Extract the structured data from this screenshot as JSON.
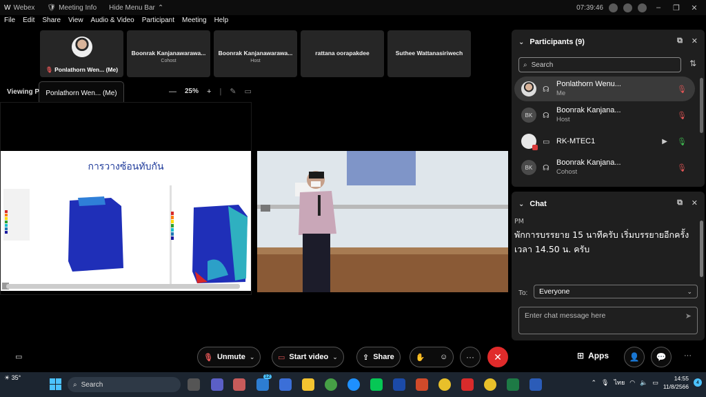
{
  "titlebar": {
    "app_name": "Webex",
    "meeting_info": "Meeting Info",
    "hide_menu": "Hide Menu Bar",
    "time": "07:39:46"
  },
  "menu": [
    "File",
    "Edit",
    "Share",
    "View",
    "Audio & Video",
    "Participant",
    "Meeting",
    "Help"
  ],
  "tiles": [
    {
      "name": "Ponlathorn Wen... (Me)",
      "role": ""
    },
    {
      "name": "Boonrak Kanjanawarawa...",
      "role": "Cohost"
    },
    {
      "name": "Boonrak Kanjanawarawa...",
      "role": "Host"
    },
    {
      "name": "rattana oorapakdee",
      "role": ""
    },
    {
      "name": "Suthee Wattanasiriwech",
      "role": ""
    }
  ],
  "tooltip": "Ponlathorn Wen... (Me)",
  "viewing_label": "Viewing P",
  "zoom": {
    "minus": "—",
    "value": "25%",
    "plus": "+"
  },
  "slide": {
    "title": "การวางซ้อนทับกัน"
  },
  "participants": {
    "title": "Participants (9)",
    "search_placeholder": "Search",
    "rows": [
      {
        "name": "Ponlathorn Wenu...",
        "role": "Me",
        "initials": "",
        "mic": "muted"
      },
      {
        "name": "Boonrak Kanjana...",
        "role": "Host",
        "initials": "BK",
        "mic": "muted"
      },
      {
        "name": "RK-MTEC1",
        "role": "",
        "initials": "",
        "mic": "on"
      },
      {
        "name": "Boonrak Kanjana...",
        "role": "Cohost",
        "initials": "BK",
        "mic": "muted"
      }
    ]
  },
  "chat": {
    "title": "Chat",
    "time_fragment": "PM",
    "message": "พักการบรรยาย 15 นาทีครับ เริ่มบรรยายอีกครั้งเวลา 14.50 น. ครับ",
    "to_label": "To:",
    "to_value": "Everyone",
    "input_placeholder": "Enter chat message here"
  },
  "controls": {
    "unmute": "Unmute",
    "start_video": "Start video",
    "share": "Share",
    "apps": "Apps",
    "more": "···"
  },
  "taskbar": {
    "weather": "35°",
    "search": "Search",
    "lang": "ไทย",
    "time": "14:55",
    "date": "11/8/2566",
    "notif_count": "4",
    "mail_badge": "12"
  },
  "colors": {
    "mute_red": "#e05555",
    "leave_red": "#e02b2b",
    "mic_green": "#3fb950",
    "slide_title_blue": "#1e3a9a"
  }
}
